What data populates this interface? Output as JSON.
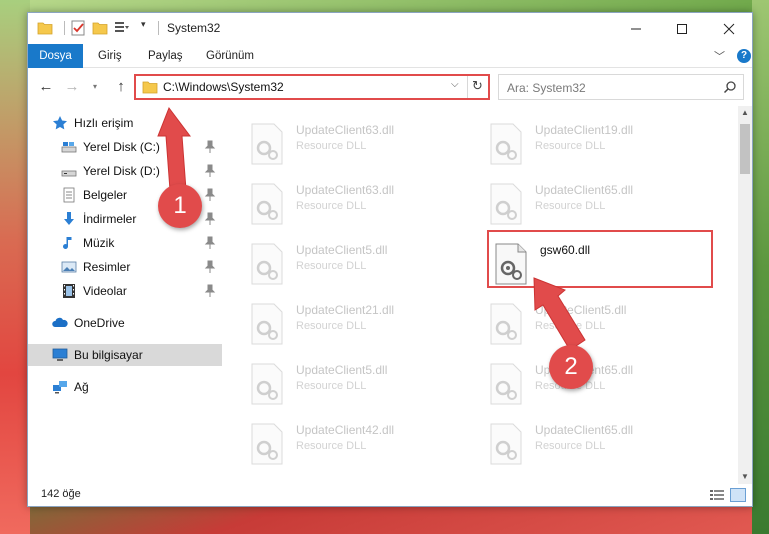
{
  "window": {
    "title": "System32",
    "controls": {
      "minimize": "minimize",
      "maximize": "maximize",
      "close": "close"
    }
  },
  "ribbon": {
    "tabs": [
      "Dosya",
      "Giriş",
      "Paylaş",
      "Görünüm"
    ],
    "help": "?"
  },
  "nav": {
    "address": "C:\\Windows\\System32",
    "search_placeholder": "Ara: System32"
  },
  "sidebar": {
    "items": [
      {
        "label": "Hızlı erişim",
        "icon": "star-icon",
        "pinned": false
      },
      {
        "label": "Yerel Disk (C:)",
        "icon": "drive-icon",
        "pinned": true
      },
      {
        "label": "Yerel Disk (D:)",
        "icon": "drive-icon",
        "pinned": true
      },
      {
        "label": "Belgeler",
        "icon": "documents-icon",
        "pinned": true
      },
      {
        "label": "İndirmeler",
        "icon": "download-icon",
        "pinned": true
      },
      {
        "label": "Müzik",
        "icon": "music-icon",
        "pinned": true
      },
      {
        "label": "Resimler",
        "icon": "pictures-icon",
        "pinned": true
      },
      {
        "label": "Videolar",
        "icon": "videos-icon",
        "pinned": true
      },
      {
        "label": "OneDrive",
        "icon": "cloud-icon",
        "pinned": false
      },
      {
        "label": "Bu bilgisayar",
        "icon": "computer-icon",
        "pinned": false,
        "selected": true
      },
      {
        "label": "Ağ",
        "icon": "network-icon",
        "pinned": false
      }
    ]
  },
  "files": [
    {
      "name": "UpdateClient63.dll",
      "type": "Resource DLL"
    },
    {
      "name": "UpdateClient19.dll",
      "type": "Resource DLL"
    },
    {
      "name": "UpdateClient63.dll",
      "type": "Resource DLL"
    },
    {
      "name": "UpdateClient65.dll",
      "type": "Resource DLL"
    },
    {
      "name": "UpdateClient5.dll",
      "type": "Resource DLL"
    },
    {
      "name": "gsw60.dll",
      "type": "",
      "highlighted": true
    },
    {
      "name": "UpdateClient21.dll",
      "type": "Resource DLL"
    },
    {
      "name": "UpdateClient5.dll",
      "type": "Resource DLL"
    },
    {
      "name": "UpdateClient5.dll",
      "type": "Resource DLL"
    },
    {
      "name": "UpdateClient65.dll",
      "type": "Resource DLL"
    },
    {
      "name": "UpdateClient42.dll",
      "type": "Resource DLL"
    },
    {
      "name": "UpdateClient65.dll",
      "type": "Resource DLL"
    }
  ],
  "status": {
    "item_count": "142 öğe"
  },
  "annotations": {
    "step1": "1",
    "step2": "2",
    "color": "#e14b4b"
  }
}
